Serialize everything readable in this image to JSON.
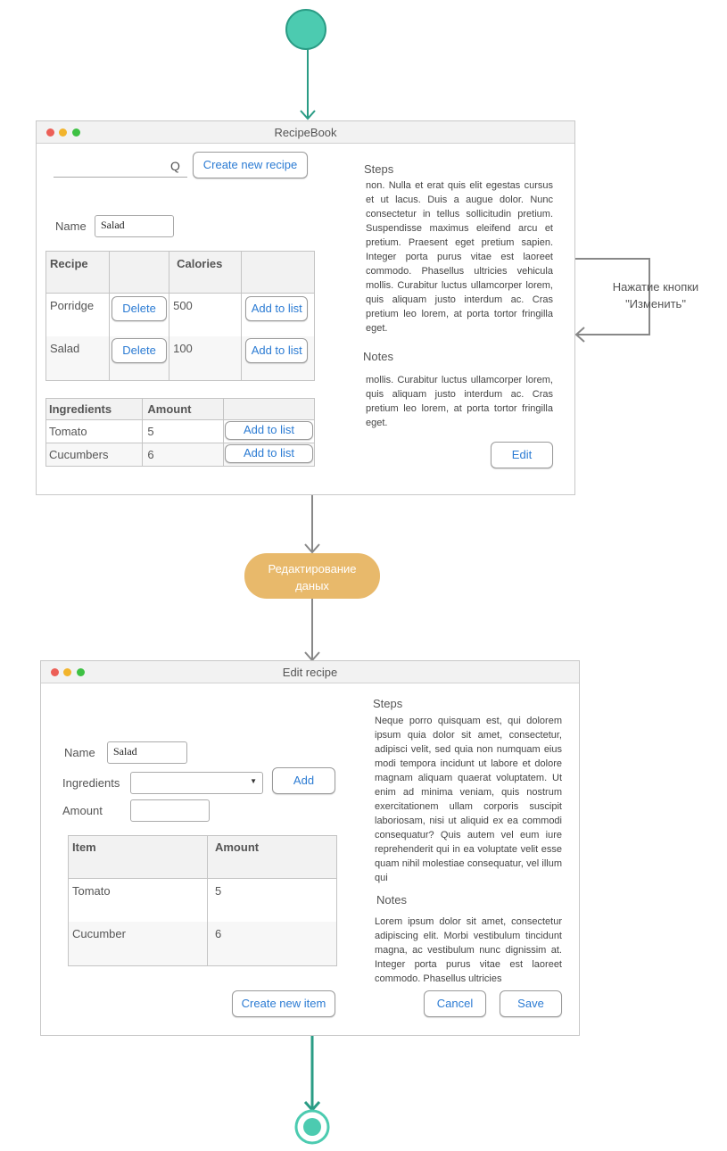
{
  "colors": {
    "accent_teal": "#4ccbb0",
    "decision_fill": "#e8b96b",
    "link_blue": "#2b7bd3",
    "dot_red": "#ec5f57",
    "dot_yellow": "#f2b42c",
    "dot_green": "#3ec144"
  },
  "window1": {
    "title": "RecipeBook",
    "search_icon": "Q",
    "create_button": "Create new recipe",
    "name_label": "Name",
    "name_value": "Salad",
    "recipes_table": {
      "headers": [
        "Recipe",
        "",
        "Calories",
        ""
      ],
      "rows": [
        {
          "recipe": "Porridge",
          "delete": "Delete",
          "calories": "500",
          "add": "Add to list"
        },
        {
          "recipe": "Salad",
          "delete": "Delete",
          "calories": "100",
          "add": "Add to list"
        }
      ]
    },
    "ingredients_table": {
      "headers": [
        "Ingredients",
        "Amount",
        ""
      ],
      "rows": [
        {
          "ingredient": "Tomato",
          "amount": "5",
          "add": "Add to list"
        },
        {
          "ingredient": "Cucumbers",
          "amount": "6",
          "add": "Add to list"
        }
      ]
    },
    "steps_heading": "Steps",
    "steps_text": "non. Nulla et erat quis elit egestas cursus et ut lacus. Duis a augue dolor. Nunc consectetur in tellus sollicitudin pretium. Suspendisse maximus eleifend arcu et pretium. Praesent eget pretium sapien. Integer porta purus vitae est laoreet commodo. Phasellus ultricies vehicula mollis. Curabitur luctus ullamcorper lorem, quis aliquam justo interdum ac. Cras pretium leo lorem, at porta tortor fringilla eget.",
    "notes_heading": "Notes",
    "notes_text": "mollis. Curabitur luctus ullamcorper lorem, quis aliquam justo interdum ac. Cras pretium leo lorem, at porta tortor fringilla eget.",
    "edit_button": "Edit"
  },
  "loop_label": "Нажатие кнопки \"Изменить\"",
  "decision_label": "Редактирование даных",
  "window2": {
    "title": "Edit recipe",
    "name_label": "Name",
    "name_value": "Salad",
    "ingredients_label": "Ingredients",
    "amount_label": "Amount",
    "add_button": "Add",
    "items_table": {
      "headers": [
        "Item",
        "Amount"
      ],
      "rows": [
        {
          "item": "Tomato",
          "amount": "5"
        },
        {
          "item": "Cucumber",
          "amount": "6"
        }
      ]
    },
    "create_item_button": "Create new item",
    "steps_heading": "Steps",
    "steps_text": "Neque porro quisquam est, qui dolorem ipsum quia dolor sit amet, consectetur, adipisci velit, sed quia non numquam eius modi tempora incidunt ut labore et dolore magnam aliquam quaerat voluptatem. Ut enim ad minima veniam, quis nostrum exercitationem ullam corporis suscipit laboriosam, nisi ut aliquid ex ea commodi consequatur? Quis autem vel eum iure reprehenderit qui in ea voluptate velit esse quam nihil molestiae consequatur, vel illum qui",
    "notes_heading": "Notes",
    "notes_text": "Lorem ipsum dolor sit amet, consectetur adipiscing elit. Morbi vestibulum tincidunt magna, ac vestibulum nunc dignissim at. Integer porta purus vitae est laoreet commodo. Phasellus ultricies",
    "cancel_button": "Cancel",
    "save_button": "Save"
  }
}
